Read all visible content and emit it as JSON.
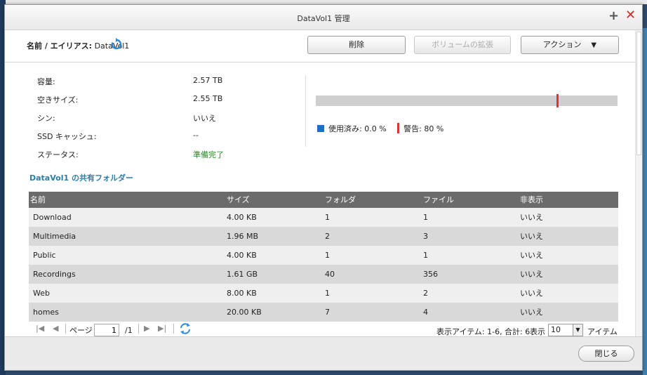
{
  "window": {
    "title": "DataVol1 管理"
  },
  "header": {
    "name_label": "名前 / エイリアス:",
    "name_value": "DataVol1",
    "buttons": {
      "delete": "削除",
      "expand": "ボリュームの拡張",
      "action": "アクション"
    }
  },
  "info": {
    "capacity": {
      "label": "容量:",
      "value": "2.57 TB"
    },
    "free": {
      "label": "空きサイズ:",
      "value": "2.55 TB"
    },
    "thin": {
      "label": "シン:",
      "value": "いいえ"
    },
    "ssd_cache": {
      "label": "SSD キャッシュ:",
      "value": "--"
    },
    "status": {
      "label": "ステータス:",
      "value": "準備完了"
    }
  },
  "usage": {
    "used_percent": 0.0,
    "warning_percent": 80,
    "used_label": "使用済み:",
    "used_value": "0.0 %",
    "warn_label": "警告:",
    "warn_value": "80 %",
    "colors": {
      "used": "#1a6fc9",
      "warning": "#d63a2e",
      "track": "#cfcfcf"
    }
  },
  "folders": {
    "title": "DataVol1 の共有フォルダー",
    "columns": [
      "名前",
      "サイズ",
      "フォルダ",
      "ファイル",
      "非表示"
    ],
    "rows": [
      [
        "Download",
        "4.00 KB",
        "1",
        "1",
        "いいえ"
      ],
      [
        "Multimedia",
        "1.96 MB",
        "2",
        "3",
        "いいえ"
      ],
      [
        "Public",
        "4.00 KB",
        "1",
        "1",
        "いいえ"
      ],
      [
        "Recordings",
        "1.61 GB",
        "40",
        "356",
        "いいえ"
      ],
      [
        "Web",
        "8.00 KB",
        "1",
        "2",
        "いいえ"
      ],
      [
        "homes",
        "20.00 KB",
        "7",
        "4",
        "いいえ"
      ]
    ]
  },
  "pager": {
    "page_label": "ページ",
    "page_value": "1",
    "total_pages": "/1",
    "items_info": "表示アイテム: 1-6, 合計: 6",
    "show_label": "表示",
    "per_page": "10",
    "unit_label": "アイテム"
  },
  "footer": {
    "close_label": "閉じる"
  }
}
